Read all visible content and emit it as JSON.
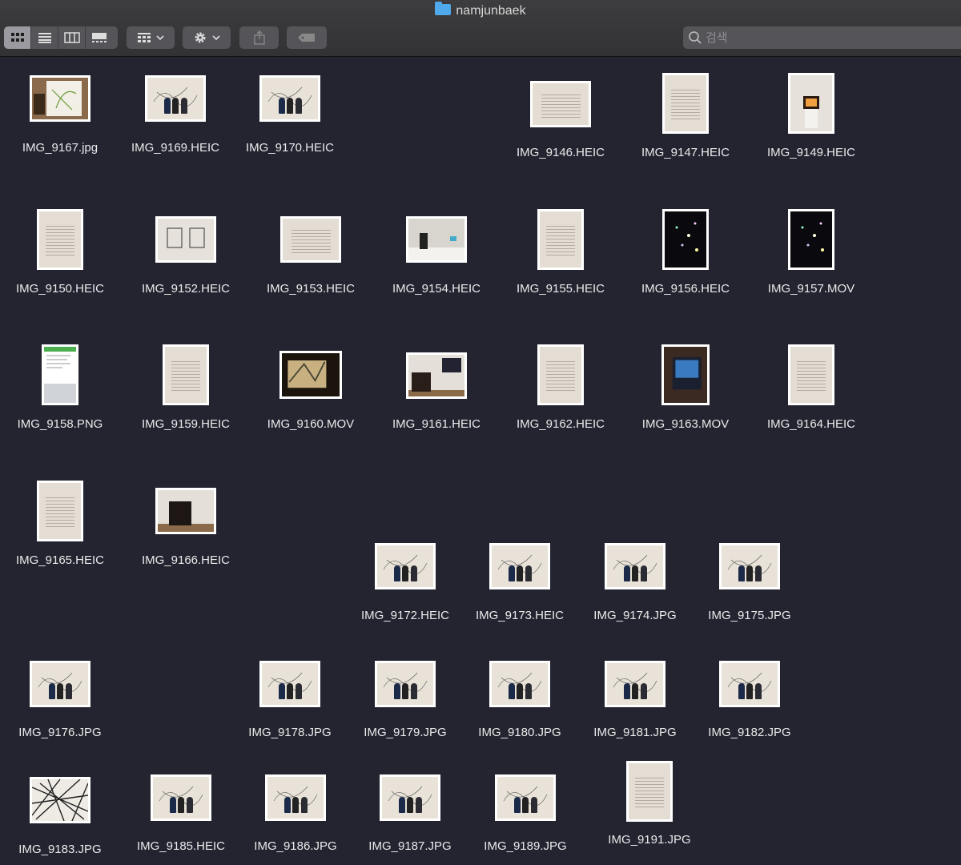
{
  "window": {
    "title": "namjunbaek"
  },
  "toolbar": {
    "view_buttons": [
      {
        "icon": "icon-view-grid-icon",
        "active": true
      },
      {
        "icon": "list-view-icon",
        "active": false
      },
      {
        "icon": "column-view-icon",
        "active": false
      },
      {
        "icon": "gallery-view-icon",
        "active": false
      }
    ],
    "group_icon": "group-by-icon",
    "action_icon": "gear-icon",
    "share_icon": "share-icon",
    "tag_icon": "tag-icon"
  },
  "search": {
    "placeholder": "검색",
    "value": ""
  },
  "colors": {
    "background": "#232430",
    "toolbar": "#323234",
    "label": "#eaeaea",
    "folder": "#4fa9ea"
  },
  "files": [
    {
      "name": "IMG_9167.jpg",
      "kind": "drawing"
    },
    {
      "name": "IMG_9169.HEIC",
      "kind": "wall"
    },
    {
      "name": "IMG_9170.HEIC",
      "kind": "wall"
    },
    {
      "name": "IMG_9146.HEIC",
      "kind": "text-landscape"
    },
    {
      "name": "IMG_9147.HEIC",
      "kind": "text"
    },
    {
      "name": "IMG_9149.HEIC",
      "kind": "tv"
    },
    {
      "name": "IMG_9150.HEIC",
      "kind": "text"
    },
    {
      "name": "IMG_9152.HEIC",
      "kind": "frames"
    },
    {
      "name": "IMG_9153.HEIC",
      "kind": "text-landscape"
    },
    {
      "name": "IMG_9154.HEIC",
      "kind": "sculpture"
    },
    {
      "name": "IMG_9155.HEIC",
      "kind": "text"
    },
    {
      "name": "IMG_9156.HEIC",
      "kind": "dark"
    },
    {
      "name": "IMG_9157.MOV",
      "kind": "dark"
    },
    {
      "name": "IMG_9158.PNG",
      "kind": "phone"
    },
    {
      "name": "IMG_9159.HEIC",
      "kind": "text"
    },
    {
      "name": "IMG_9160.MOV",
      "kind": "video"
    },
    {
      "name": "IMG_9161.HEIC",
      "kind": "piano-screen"
    },
    {
      "name": "IMG_9162.HEIC",
      "kind": "text"
    },
    {
      "name": "IMG_9163.MOV",
      "kind": "video-portrait"
    },
    {
      "name": "IMG_9164.HEIC",
      "kind": "text"
    },
    {
      "name": "IMG_9165.HEIC",
      "kind": "text"
    },
    {
      "name": "IMG_9166.HEIC",
      "kind": "piano"
    },
    {
      "name": "IMG_9172.HEIC",
      "kind": "wall"
    },
    {
      "name": "IMG_9173.HEIC",
      "kind": "wall"
    },
    {
      "name": "IMG_9174.JPG",
      "kind": "wall"
    },
    {
      "name": "IMG_9175.JPG",
      "kind": "wall"
    },
    {
      "name": "IMG_9176.JPG",
      "kind": "wall"
    },
    {
      "name": "IMG_9178.JPG",
      "kind": "wall"
    },
    {
      "name": "IMG_9179.JPG",
      "kind": "wall"
    },
    {
      "name": "IMG_9180.JPG",
      "kind": "wall"
    },
    {
      "name": "IMG_9181.JPG",
      "kind": "wall"
    },
    {
      "name": "IMG_9182.JPG",
      "kind": "wall"
    },
    {
      "name": "IMG_9183.JPG",
      "kind": "lines"
    },
    {
      "name": "IMG_9185.HEIC",
      "kind": "wall"
    },
    {
      "name": "IMG_9186.JPG",
      "kind": "wall"
    },
    {
      "name": "IMG_9187.JPG",
      "kind": "wall"
    },
    {
      "name": "IMG_9189.JPG",
      "kind": "wall"
    },
    {
      "name": "IMG_9191.JPG",
      "kind": "text"
    }
  ]
}
